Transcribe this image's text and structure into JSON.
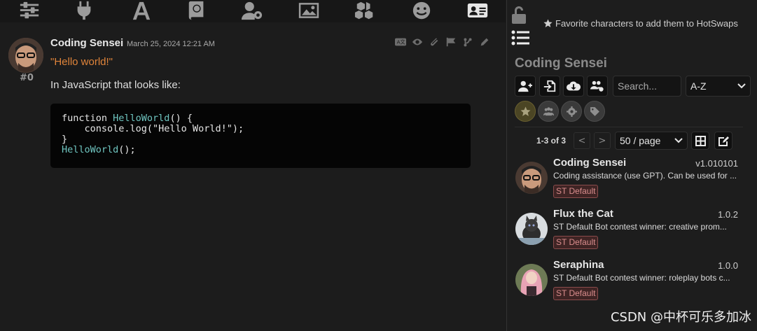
{
  "nav": {
    "icons": [
      "sliders-icon",
      "plug-icon",
      "font-icon",
      "book-atlas-icon",
      "user-gear-icon",
      "image-icon",
      "cubes-icon",
      "smile-icon",
      "address-card-icon"
    ],
    "active": "address-card-icon"
  },
  "message": {
    "author": "Coding Sensei",
    "date": "March 25, 2024 12:21 AM",
    "index": "#0",
    "quote": "\"Hello world!\"",
    "text": "In JavaScript that looks like:",
    "code_lines": [
      {
        "pre": "function ",
        "fn": "HelloWorld",
        "post": "() {"
      },
      {
        "pre": "    console.log(\"Hello World!\");",
        "fn": "",
        "post": ""
      },
      {
        "pre": "}",
        "fn": "",
        "post": ""
      },
      {
        "pre": "",
        "fn": "HelloWorld",
        "post": "();"
      }
    ],
    "tools": [
      "translate-icon",
      "eye-icon",
      "paperclip-icon",
      "flag-icon",
      "branch-icon",
      "pencil-icon"
    ]
  },
  "panel": {
    "fav_hint": "Favorite characters to add them to HotSwaps",
    "title": "Coding Sensei",
    "search_placeholder": "Search...",
    "sort_value": "A-Z",
    "pager_count": "1-3 of 3",
    "prev": "<",
    "next": ">",
    "per_page": "50 / page",
    "characters": [
      {
        "name": "Coding Sensei",
        "version": "v1.010101",
        "desc": "Coding assistance (use GPT). Can be used for ...",
        "tag": "ST Default"
      },
      {
        "name": "Flux the Cat",
        "version": "1.0.2",
        "desc": "ST Default Bot contest winner: creative prom...",
        "tag": "ST Default"
      },
      {
        "name": "Seraphina",
        "version": "1.0.0",
        "desc": "ST Default Bot contest winner: roleplay bots c...",
        "tag": "ST Default"
      }
    ]
  },
  "watermark": "CSDN @中杯可乐多加冰",
  "colors": {
    "accent_orange": "#e0843a",
    "code_fn": "#6fc5c0",
    "tag_red": "#d98d8d"
  }
}
